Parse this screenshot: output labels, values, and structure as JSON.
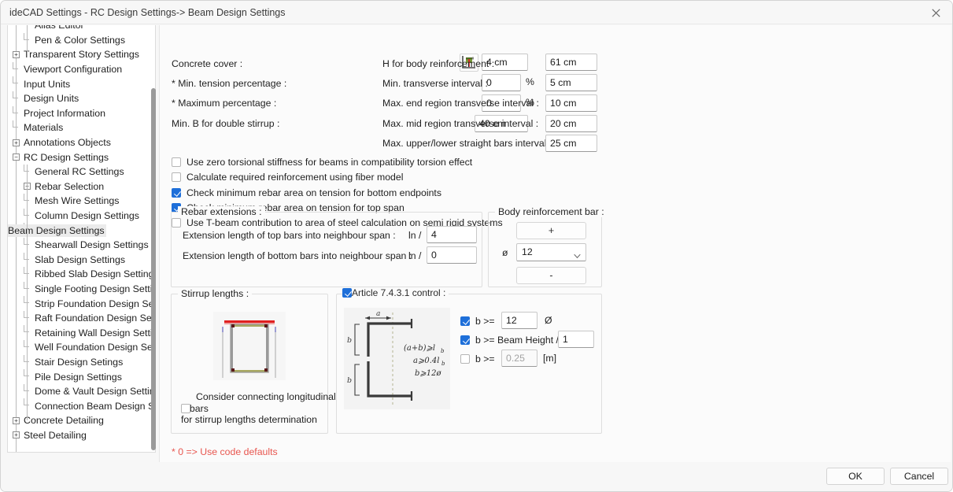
{
  "window": {
    "title": "ideCAD Settings - RC Design Settings-> Beam Design Settings",
    "close_icon": "close-icon"
  },
  "sidebar": {
    "items": [
      {
        "label": "Alias Editor",
        "level": 2,
        "expander": "none",
        "selected": false
      },
      {
        "label": "Pen & Color Settings",
        "level": 2,
        "expander": "none",
        "selected": false
      },
      {
        "label": "Transparent Story Settings",
        "level": 1,
        "expander": "plus",
        "selected": false
      },
      {
        "label": "Viewport Configuration",
        "level": 1,
        "expander": "none",
        "selected": false
      },
      {
        "label": "Input Units",
        "level": 1,
        "expander": "none",
        "selected": false
      },
      {
        "label": "Design Units",
        "level": 1,
        "expander": "none",
        "selected": false
      },
      {
        "label": "Project Information",
        "level": 1,
        "expander": "none",
        "selected": false
      },
      {
        "label": "Materials",
        "level": 1,
        "expander": "none",
        "selected": false
      },
      {
        "label": "Annotations Objects",
        "level": 1,
        "expander": "plus",
        "selected": false
      },
      {
        "label": "RC Design Settings",
        "level": 1,
        "expander": "minus",
        "selected": false
      },
      {
        "label": "General RC Settings",
        "level": 2,
        "expander": "none",
        "selected": false
      },
      {
        "label": "Rebar Selection",
        "level": 2,
        "expander": "plus",
        "selected": false
      },
      {
        "label": "Mesh Wire Settings",
        "level": 2,
        "expander": "none",
        "selected": false
      },
      {
        "label": "Column Design Settings",
        "level": 2,
        "expander": "none",
        "selected": false
      },
      {
        "label": "Beam Design Settings",
        "level": 2,
        "expander": "none",
        "selected": true
      },
      {
        "label": "Shearwall Design Settings",
        "level": 2,
        "expander": "none",
        "selected": false
      },
      {
        "label": "Slab Design Settings",
        "level": 2,
        "expander": "none",
        "selected": false
      },
      {
        "label": "Ribbed Slab Design Settings",
        "level": 2,
        "expander": "none",
        "selected": false
      },
      {
        "label": "Single Footing Design Settin",
        "level": 2,
        "expander": "none",
        "selected": false
      },
      {
        "label": "Strip Foundation Design Set",
        "level": 2,
        "expander": "none",
        "selected": false
      },
      {
        "label": "Raft Foundation Design Sett",
        "level": 2,
        "expander": "none",
        "selected": false
      },
      {
        "label": "Retaining Wall Design Settin",
        "level": 2,
        "expander": "none",
        "selected": false
      },
      {
        "label": "Well Foundation Design Sett",
        "level": 2,
        "expander": "none",
        "selected": false
      },
      {
        "label": "Stair Design Setings",
        "level": 2,
        "expander": "none",
        "selected": false
      },
      {
        "label": "Pile Design Settings",
        "level": 2,
        "expander": "none",
        "selected": false
      },
      {
        "label": "Dome & Vault Design Settin",
        "level": 2,
        "expander": "none",
        "selected": false
      },
      {
        "label": "Connection Beam Design Se",
        "level": 2,
        "expander": "none",
        "selected": false
      },
      {
        "label": "Concrete Detailing",
        "level": 1,
        "expander": "plus",
        "selected": false
      },
      {
        "label": "Steel Detailing",
        "level": 1,
        "expander": "plus",
        "selected": false
      }
    ]
  },
  "main": {
    "left_fields": [
      {
        "label": "Concrete cover :",
        "value": "4 cm",
        "unit": ""
      },
      {
        "label": "* Min. tension percentage :",
        "value": "0",
        "unit": "%"
      },
      {
        "label": "* Maximum percentage :",
        "value": "0",
        "unit": "%"
      },
      {
        "label": "Min. B for double stirrup :",
        "value": "40 cm",
        "unit": ""
      }
    ],
    "cover_icon": "concrete-cover-icon",
    "right_fields": [
      {
        "label": "H for body reinforcement :",
        "value": "61 cm"
      },
      {
        "label": "Min. transverse interval :",
        "value": "5 cm"
      },
      {
        "label": "Max. end region transverse interval :",
        "value": "10 cm"
      },
      {
        "label": "Max. mid region transverse interval :",
        "value": "20 cm"
      },
      {
        "label": "Max. upper/lower straight bars interval :",
        "value": "25 cm"
      }
    ],
    "checkboxes": [
      {
        "label": "Use zero torsional stiffness for beams in compatibility torsion effect",
        "checked": false
      },
      {
        "label": "Calculate required reinforcement using fiber model",
        "checked": false
      },
      {
        "label": "Check minimum rebar area on tension for bottom endpoints",
        "checked": true
      },
      {
        "label": "Check minimum rebar area on tension for top span",
        "checked": true
      },
      {
        "label": "Use T-beam contribution to area of steel calculation on semi rigid systems",
        "checked": false
      }
    ],
    "rebar_extensions": {
      "title": "Rebar extensions :",
      "rows": [
        {
          "label": "Extension length of top bars into neighbour span :",
          "prefix": "ln /",
          "value": "4"
        },
        {
          "label": "Extension length of bottom bars into neighbour span :",
          "prefix": "ln /",
          "value": "0"
        }
      ]
    },
    "body_reinforcement": {
      "title": "Body reinforcement bar :",
      "plus_label": "+",
      "minus_label": "-",
      "diameter_symbol": "ø",
      "diameter_value": "12"
    },
    "stirrup_lengths": {
      "title": "Stirrup lengths :",
      "diagram": "stirrup-section-diagram",
      "checkbox": {
        "line1": "Consider connecting longitudinal",
        "line2": "rebars",
        "line3": "for stirrup lengths determination",
        "checked": false
      }
    },
    "article_control": {
      "title": "Article 7.4.3.1 control :",
      "checked": true,
      "diagram": "hook-length-diagram",
      "diagram_notes": [
        "(a+b) ⩾ ℓb",
        "a ⩾ 0.4ℓb",
        "b ⩾ 12ø"
      ],
      "rows": [
        {
          "checked": true,
          "label": "b >=",
          "value": "12",
          "suffix": "Ø",
          "disabled": false
        },
        {
          "checked": true,
          "label": "b >= Beam Height /",
          "value": "1",
          "suffix": "",
          "disabled": false
        },
        {
          "checked": false,
          "label": "b >=",
          "value": "0.25",
          "suffix": "[m]",
          "disabled": true
        }
      ]
    },
    "footnote": "* 0 => Use code defaults"
  },
  "footer": {
    "ok_label": "OK",
    "cancel_label": "Cancel"
  },
  "colors": {
    "accent": "#1e6fd9",
    "note": "#e8564f",
    "panel": "#fbfbfb"
  }
}
